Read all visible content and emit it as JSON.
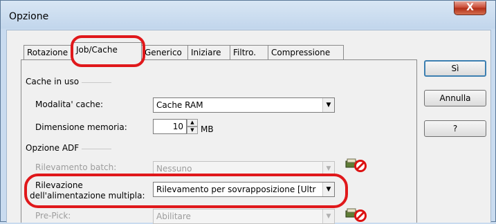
{
  "window": {
    "title": "Opzione",
    "close_glyph": "X"
  },
  "tabs": [
    {
      "label": "Rotazione"
    },
    {
      "label": "Job/Cache"
    },
    {
      "label": "Generico"
    },
    {
      "label": "Iniziare"
    },
    {
      "label": "Filtro."
    },
    {
      "label": "Compressione"
    }
  ],
  "active_tab": "Job/Cache",
  "cache_group": {
    "title": "Cache in uso",
    "mode_label": "Modalita' cache:",
    "mode_value": "Cache RAM",
    "memory_label": "Dimensione memoria:",
    "memory_value": "10",
    "memory_unit": "MB"
  },
  "adf_group": {
    "title": "Opzione ADF",
    "batch_label": "Rilevamento batch:",
    "batch_value": "Nessuno",
    "multifeed_label_line1": "Rilevazione",
    "multifeed_label_line2": "dell'alimentazione multipla:",
    "multifeed_value": "Rilevamento per sovrapposizione [Ultr",
    "prepick_label": "Pre-Pick:",
    "prepick_value": "Abilitare"
  },
  "buttons": {
    "ok": "Sì",
    "cancel": "Annulla",
    "help": "?"
  },
  "icons": {
    "unavailable": "scanner-disabled-icon"
  },
  "colors": {
    "highlight": "#e0181b",
    "default_button_border": "#3c7fb1"
  }
}
